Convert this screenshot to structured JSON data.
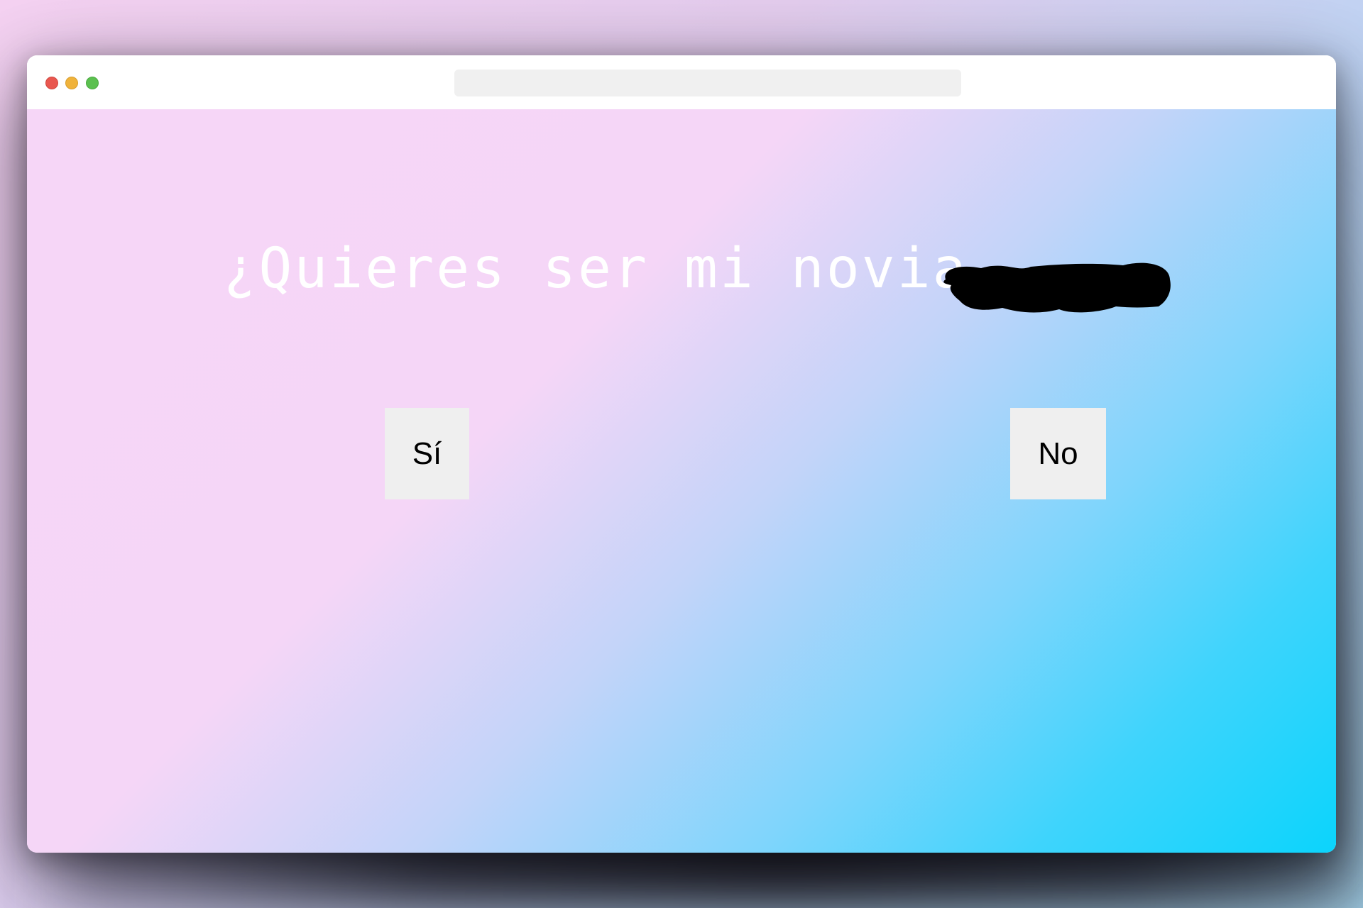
{
  "page": {
    "background_gradient": [
      "#f5d2f2",
      "#e4cdee",
      "#bcd4f4",
      "#a9d9f0"
    ],
    "viewport_gradient": [
      "#f6d6f7",
      "#c3d4f9",
      "#7ed5fc",
      "#0bd4fc"
    ]
  },
  "window": {
    "controls": {
      "close_color": "#e9574f",
      "minimize_color": "#f0b33b",
      "maximize_color": "#5bc04f"
    },
    "address_bar": {
      "value": ""
    }
  },
  "main": {
    "question": "¿Quieres ser mi novia,",
    "redacted_name_icon": "redaction-scribble",
    "yes_label": "Sí",
    "no_label": "No"
  }
}
